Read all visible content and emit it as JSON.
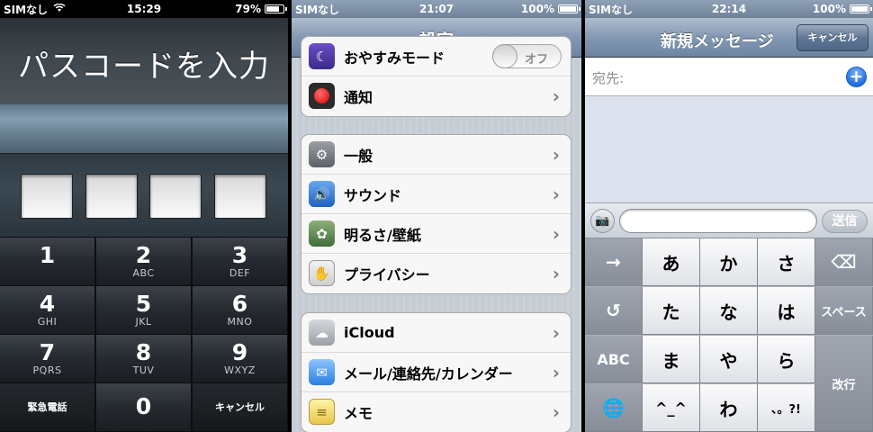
{
  "passcode_screen": {
    "status": {
      "carrier": "SIMなし",
      "time": "15:29",
      "battery": "79%",
      "battery_level": 0.79
    },
    "title": "パスコードを入力",
    "field_count": 4,
    "keys": [
      {
        "num": "1",
        "letters": ""
      },
      {
        "num": "2",
        "letters": "ABC"
      },
      {
        "num": "3",
        "letters": "DEF"
      },
      {
        "num": "4",
        "letters": "GHI"
      },
      {
        "num": "5",
        "letters": "JKL"
      },
      {
        "num": "6",
        "letters": "MNO"
      },
      {
        "num": "7",
        "letters": "PQRS"
      },
      {
        "num": "8",
        "letters": "TUV"
      },
      {
        "num": "9",
        "letters": "WXYZ"
      }
    ],
    "emergency_label": "緊急電話",
    "zero_label": "0",
    "cancel_label": "キャンセル"
  },
  "settings_screen": {
    "status": {
      "carrier": "SIMなし",
      "time": "21:07",
      "battery": "100%",
      "battery_level": 1.0
    },
    "title": "設定",
    "partial_row": {
      "label": "おやすみモード",
      "toggle_text": "オフ"
    },
    "group1": [
      {
        "label": "通知",
        "icon": "notification-icon"
      }
    ],
    "group2": [
      {
        "label": "一般",
        "icon": "gear-icon"
      },
      {
        "label": "サウンド",
        "icon": "speaker-icon"
      },
      {
        "label": "明るさ/壁紙",
        "icon": "flower-icon"
      },
      {
        "label": "プライバシー",
        "icon": "hand-icon"
      }
    ],
    "group3": [
      {
        "label": "iCloud",
        "icon": "cloud-icon"
      },
      {
        "label": "メール/連絡先/カレンダー",
        "icon": "mail-icon"
      },
      {
        "label": "メモ",
        "icon": "notes-icon"
      }
    ]
  },
  "message_screen": {
    "status": {
      "carrier": "SIMなし",
      "time": "22:14",
      "battery": "100%",
      "battery_level": 1.0
    },
    "title": "新規メッセージ",
    "cancel_label": "キャンセル",
    "to_label": "宛先:",
    "send_label": "送信",
    "keyboard": {
      "row1": [
        "→",
        "あ",
        "か",
        "さ",
        "⌫"
      ],
      "row2": [
        "↺",
        "た",
        "な",
        "は",
        "スペース"
      ],
      "row3": [
        "ABC",
        "ま",
        "や",
        "ら",
        "改行"
      ],
      "row4": [
        "🌐",
        "^_^",
        "わ",
        "、。?!"
      ]
    }
  },
  "colors": {
    "nav_blue": "#6d84a2",
    "settings_bg": "#c5ccd4",
    "keyboard_bg": "#adb2bb"
  }
}
